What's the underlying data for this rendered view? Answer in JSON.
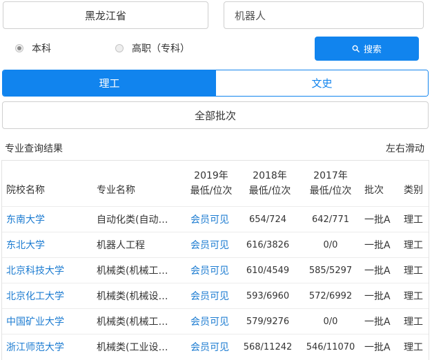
{
  "search": {
    "province": "黑龙江省",
    "keyword": "机器人",
    "button_label": "搜索"
  },
  "level_options": [
    {
      "label": "本科",
      "checked": true
    },
    {
      "label": "高职（专科）",
      "checked": false
    }
  ],
  "subject_tabs": [
    {
      "label": "理工",
      "active": true
    },
    {
      "label": "文史",
      "active": false
    }
  ],
  "batch_select": "全部批次",
  "results": {
    "title": "专业查询结果",
    "scroll_hint": "左右滑动",
    "headers": {
      "school": "院校名称",
      "major": "专业名称",
      "y2019": [
        "2019年",
        "最低/位次"
      ],
      "y2018": [
        "2018年",
        "最低/位次"
      ],
      "y2017": [
        "2017年",
        "最低/位次"
      ],
      "batch": "批次",
      "type": "类别"
    },
    "rows": [
      {
        "school": "东南大学",
        "major": "自动化类(自动化)",
        "y2019": "会员可见",
        "y2018": "654/724",
        "y2017": "642/771",
        "batch": "一批A",
        "type": "理工"
      },
      {
        "school": "东北大学",
        "major": "机器人工程",
        "y2019": "会员可见",
        "y2018": "616/3826",
        "y2017": "0/0",
        "batch": "一批A",
        "type": "理工"
      },
      {
        "school": "北京科技大学",
        "major": "机械类(机械工程)",
        "y2019": "会员可见",
        "y2018": "610/4549",
        "y2017": "585/5297",
        "batch": "一批A",
        "type": "理工"
      },
      {
        "school": "北京化工大学",
        "major": "机械类(机械设计)",
        "y2019": "会员可见",
        "y2018": "593/6960",
        "y2017": "572/6992",
        "batch": "一批A",
        "type": "理工"
      },
      {
        "school": "中国矿业大学",
        "major": "机械类(机械工程)",
        "y2019": "会员可见",
        "y2018": "579/9276",
        "y2017": "0/0",
        "batch": "一批A",
        "type": "理工"
      },
      {
        "school": "浙江师范大学",
        "major": "机械类(工业设计)",
        "y2019": "会员可见",
        "y2018": "568/11242",
        "y2017": "546/11070",
        "batch": "一批A",
        "type": "理工"
      }
    ]
  },
  "colors": {
    "accent": "#1184ee",
    "link": "#1b7bd1"
  },
  "icons": {
    "search_button": "search-icon"
  }
}
